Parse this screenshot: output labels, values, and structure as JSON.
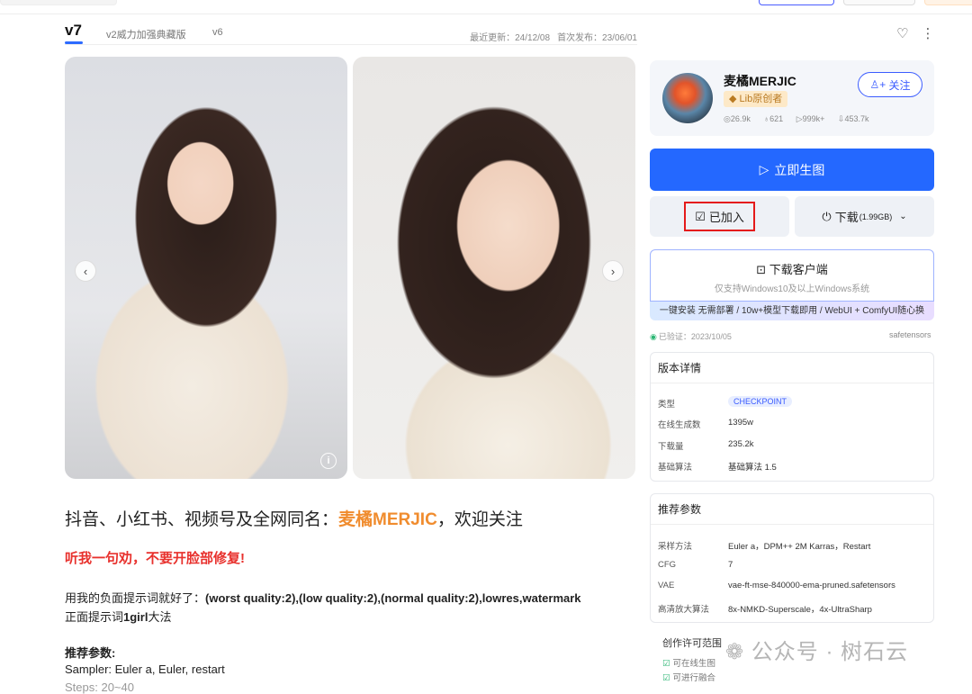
{
  "tabs": {
    "active": "v7",
    "second": "v2威力加强典藏版",
    "third": "v6"
  },
  "dates": {
    "updated": "最近更新：24/12/08",
    "published": "首次发布：23/06/01"
  },
  "icons": {
    "favorite": "heart-icon",
    "more": "more-vert-icon"
  },
  "images": {
    "info": "i"
  },
  "description": {
    "prefix": "抖音、小红书、视频号及全网同名：",
    "brand": "麦橘MERJIC",
    "suffix": "，欢迎关注",
    "warning": "听我一句劝，不要开脸部修复!",
    "neg_prefix": "用我的负面提示词就好了：",
    "neg_value": "(worst quality:2),(low quality:2),(normal quality:2),lowres,watermark",
    "pos_prefix": "正面提示词",
    "pos_value": "1girl",
    "pos_suffix": "大法",
    "params_heading": "推荐参数:",
    "sampler": "Sampler: Euler a, Euler, restart",
    "steps": "Steps: 20~40"
  },
  "author": {
    "name": "麦橘MERJIC",
    "badge": "Lib原创者",
    "stats": {
      "a": "26.9k",
      "b": "621",
      "c": "999k+",
      "d": "453.7k"
    },
    "follow": "关注"
  },
  "actions": {
    "generate": "立即生图",
    "added": "已加入",
    "download": "下载",
    "download_size": "(1.99GB)",
    "client_title": "下载客户端",
    "client_sub": "仅支持Windows10及以上Windows系统",
    "client_banner": "一键安装 无需部署 / 10w+模型下载即用 / WebUI + ComfyUI随心换"
  },
  "verify": {
    "text": "已验证：2023/10/05",
    "format": "safetensors"
  },
  "version_details": {
    "title": "版本详情",
    "rows": [
      {
        "k": "类型",
        "v": "CHECKPOINT"
      },
      {
        "k": "在线生成数",
        "v": "1395w"
      },
      {
        "k": "下载量",
        "v": "235.2k"
      },
      {
        "k": "基础算法",
        "v": "基础算法 1.5"
      }
    ]
  },
  "recommended": {
    "title": "推荐参数",
    "rows": [
      {
        "k": "采样方法",
        "v": "Euler a，DPM++ 2M Karras，Restart"
      },
      {
        "k": "CFG",
        "v": "7"
      },
      {
        "k": "VAE",
        "v": "vae-ft-mse-840000-ema-pruned.safetensors"
      },
      {
        "k": "高清放大算法",
        "v": "8x-NMKD-Superscale，4x-UltraSharp"
      }
    ]
  },
  "license": {
    "title": "创作许可范围",
    "items": [
      "可在线生图",
      "可进行融合"
    ]
  },
  "watermark": "公众号 · 树石云",
  "colors": {
    "primary": "#2468ff",
    "brand_orange": "#f08c2e",
    "warning_red": "#e8312d",
    "highlight_box": "#e41a1a"
  }
}
